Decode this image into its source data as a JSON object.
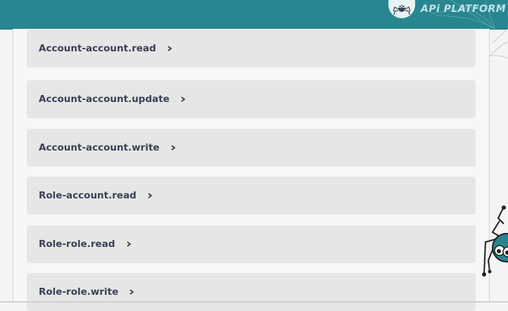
{
  "header": {
    "logo_text": "APi PLATFORM",
    "bg_color": "#288690"
  },
  "models": [
    {
      "name": "Account-account.read",
      "icon": "chevron-right-icon"
    },
    {
      "name": "Account-account.update",
      "icon": "chevron-right-icon"
    },
    {
      "name": "Account-account.write",
      "icon": "chevron-right-icon"
    },
    {
      "name": "Role-account.read",
      "icon": "chevron-right-icon"
    },
    {
      "name": "Role-role.read",
      "icon": "chevron-right-icon"
    },
    {
      "name": "Role-role.write",
      "icon": "chevron-right-icon"
    }
  ],
  "colors": {
    "card_bg": "#e6e6e6",
    "text": "#3b4151",
    "accent": "#288690"
  }
}
